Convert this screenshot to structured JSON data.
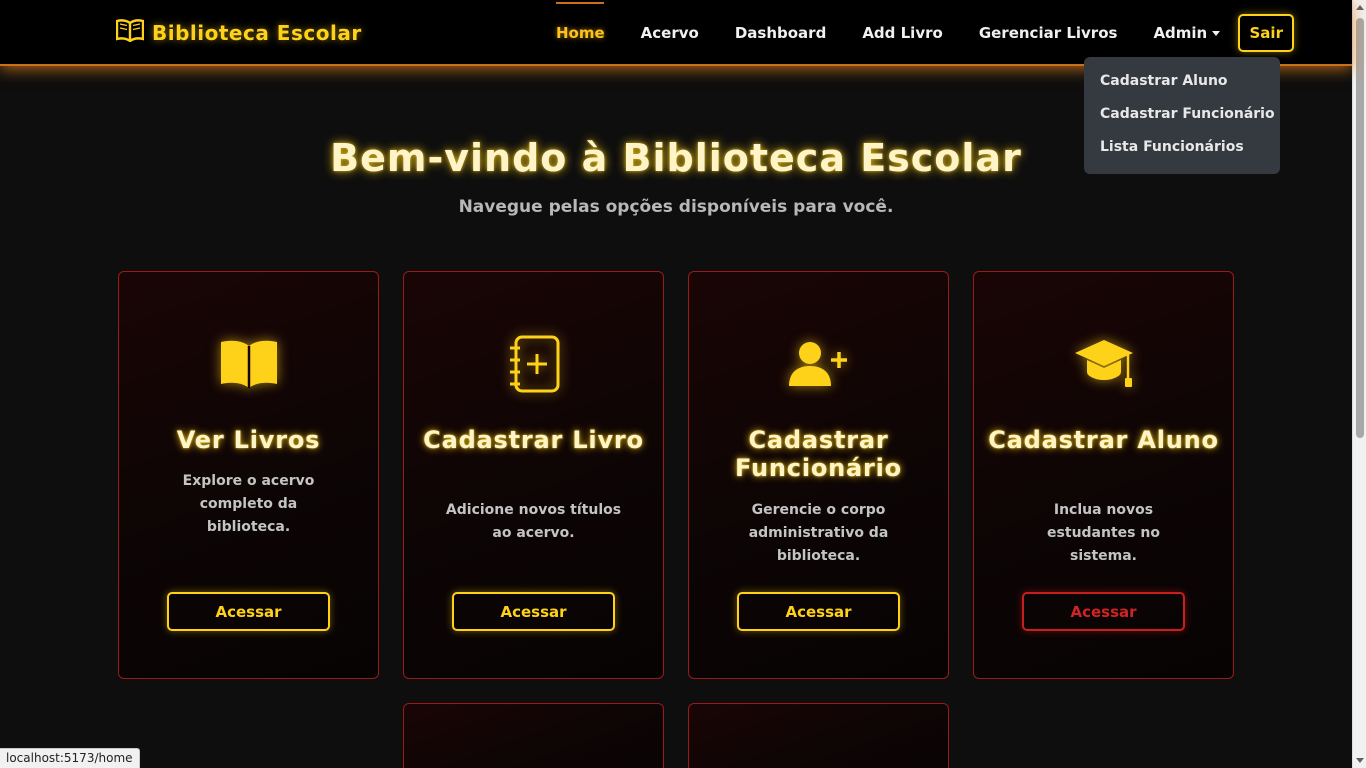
{
  "navbar": {
    "brand": "Biblioteca Escolar",
    "links": [
      "Home",
      "Acervo",
      "Dashboard",
      "Add Livro",
      "Gerenciar Livros"
    ],
    "admin_label": "Admin",
    "logout_label": "Sair"
  },
  "dropdown": {
    "items": [
      "Cadastrar Aluno",
      "Cadastrar Funcionário",
      "Lista Funcionários"
    ]
  },
  "hero": {
    "title": "Bem-vindo à Biblioteca Escolar",
    "subtitle": "Navegue pelas opções disponíveis para você."
  },
  "cards": [
    {
      "icon": "book-open-icon",
      "title": "Ver Livros",
      "description": "Explore o acervo completo da biblioteca.",
      "button": "Acessar"
    },
    {
      "icon": "book-add-icon",
      "title": "Cadastrar Livro",
      "description": "Adicione novos títulos ao acervo.",
      "button": "Acessar"
    },
    {
      "icon": "user-add-icon",
      "title": "Cadastrar Funcionário",
      "description": "Gerencie o corpo administrativo da biblioteca.",
      "button": "Acessar"
    },
    {
      "icon": "graduation-cap-icon",
      "title": "Cadastrar Aluno",
      "description": "Inclua novos estudantes no sistema.",
      "button": "Acessar"
    }
  ],
  "colors": {
    "accent": "#ffd21a",
    "danger": "#c81e1e",
    "glow": "#c8711a",
    "background": "#0e0e0e"
  },
  "status_url": "localhost:5173/home"
}
